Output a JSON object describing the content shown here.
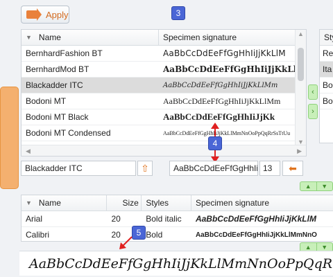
{
  "toolbar": {
    "apply_label": "Apply"
  },
  "badges": {
    "b3": "3",
    "b4": "4",
    "b5": "5"
  },
  "fonts_grid": {
    "columns": [
      "Name",
      "Specimen signature"
    ],
    "rows": [
      {
        "name": "BernhardFashion BT",
        "specimen": "AaBbCcDdEeFfGgHhIiJjKkLlM"
      },
      {
        "name": "BernhardMod BT",
        "specimen": "AaBbCcDdEeFfGgHhIiJjKkLlM"
      },
      {
        "name": "Blackadder ITC",
        "specimen": "AaBbCcDdEeFfGgHhIiJjKkLlMm"
      },
      {
        "name": "Bodoni MT",
        "specimen": "AaBbCcDdEeFfGgHhIiJjKkLlMm"
      },
      {
        "name": "Bodoni MT Black",
        "specimen": "AaBbCcDdEeFfGgHhIiJjKk"
      },
      {
        "name": "Bodoni MT Condensed",
        "specimen": "AaBbCcDdEeFfGgHhIiJjKkLlMmNnOoPpQqRrSsTtUu"
      }
    ]
  },
  "styles_grid": {
    "header": "Sty",
    "rows": [
      "Re",
      "Ita",
      "Bo",
      "Bo"
    ]
  },
  "editor": {
    "font_name": "Blackadder ITC",
    "specimen": "AaBbCcDdEeFfGgHhIi",
    "size": "13"
  },
  "selected_grid": {
    "columns": [
      "Name",
      "Size",
      "Styles",
      "Specimen signature"
    ],
    "rows": [
      {
        "name": "Arial",
        "size": "20",
        "styles": "Bold italic",
        "specimen": "AaBbCcDdEeFfGgHhIiJjKkLlM"
      },
      {
        "name": "Calibri",
        "size": "20",
        "styles": "Bold",
        "specimen": "AaBbCcDdEeFfGgHhIiJjKkLlMmNnO"
      }
    ]
  },
  "preview_text": "AaBbCcDdEeFfGgHhIiJjKkLlMmNnOoPpQqRrSs",
  "colors": {
    "accent_orange": "#e9813b",
    "badge_blue": "#4a66d6",
    "green": "#c8efb9",
    "red_arrow": "#e02020"
  }
}
